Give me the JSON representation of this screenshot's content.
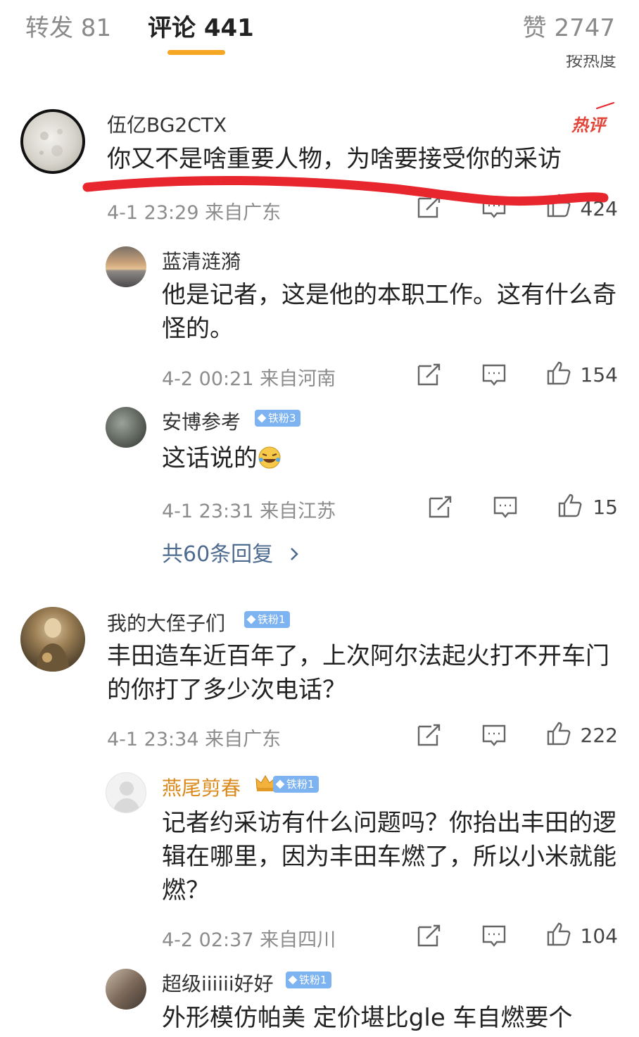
{
  "tabs": {
    "repost": "转发 81",
    "comments": "评论 441",
    "likes": "赞 2747",
    "sort": "按热度"
  },
  "colors": {
    "accent": "#f5a623",
    "hot": "#e2453a",
    "link": "#4d6a8f",
    "badge": "#7db3f0",
    "annotation": "#e8262e"
  },
  "comments": [
    {
      "user": "伍亿BG2CTX",
      "text": "你又不是啥重要人物，为啥要接受你的采访",
      "meta": "4-1 23:29 来自广东",
      "likes": "424",
      "tag": "热评",
      "replies": [
        {
          "user": "蓝清涟漪",
          "text": "他是记者，这是他的本职工作。这有什么奇怪的。",
          "meta": "4-2 00:21 来自河南",
          "likes": "154"
        },
        {
          "user": "安博参考",
          "badge": "铁粉3",
          "text": "这话说的",
          "emoji": "laugh-cry-emoji",
          "meta": "4-1 23:31 来自江苏",
          "likes": "15"
        }
      ],
      "more_replies": "共60条回复"
    },
    {
      "user": "我的大侄子们",
      "badge": "铁粉1",
      "text": "丰田造车近百年了，上次阿尔法起火打不开车门的你打了多少次电话？",
      "meta": "4-1 23:34 来自广东",
      "likes": "222",
      "replies": [
        {
          "user": "燕尾剪春",
          "badge": "铁粉1",
          "text": "记者约采访有什么问题吗？你抬出丰田的逻辑在哪里，因为丰田车燃了，所以小米就能燃？",
          "meta": "4-2 02:37 来自四川",
          "likes": "104"
        },
        {
          "user": "超级iiiiii好好",
          "badge": "铁粉1",
          "text": "外形模仿帕美 定价堪比gle 车自燃要个"
        }
      ]
    }
  ]
}
